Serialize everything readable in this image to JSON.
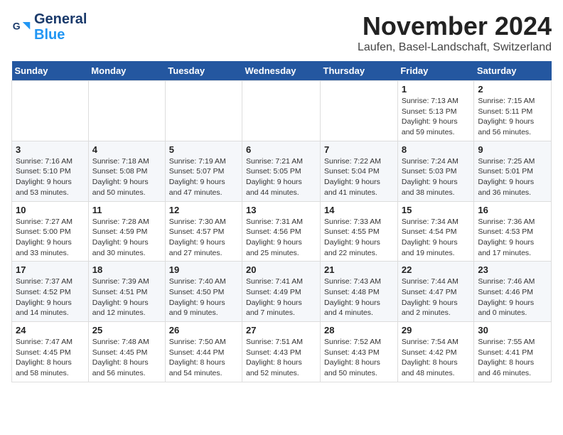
{
  "logo": {
    "line1": "General",
    "line2": "Blue"
  },
  "title": {
    "month": "November 2024",
    "location": "Laufen, Basel-Landschaft, Switzerland"
  },
  "weekdays": [
    "Sunday",
    "Monday",
    "Tuesday",
    "Wednesday",
    "Thursday",
    "Friday",
    "Saturday"
  ],
  "weeks": [
    [
      {
        "day": "",
        "info": ""
      },
      {
        "day": "",
        "info": ""
      },
      {
        "day": "",
        "info": ""
      },
      {
        "day": "",
        "info": ""
      },
      {
        "day": "",
        "info": ""
      },
      {
        "day": "1",
        "info": "Sunrise: 7:13 AM\nSunset: 5:13 PM\nDaylight: 9 hours and 59 minutes."
      },
      {
        "day": "2",
        "info": "Sunrise: 7:15 AM\nSunset: 5:11 PM\nDaylight: 9 hours and 56 minutes."
      }
    ],
    [
      {
        "day": "3",
        "info": "Sunrise: 7:16 AM\nSunset: 5:10 PM\nDaylight: 9 hours and 53 minutes."
      },
      {
        "day": "4",
        "info": "Sunrise: 7:18 AM\nSunset: 5:08 PM\nDaylight: 9 hours and 50 minutes."
      },
      {
        "day": "5",
        "info": "Sunrise: 7:19 AM\nSunset: 5:07 PM\nDaylight: 9 hours and 47 minutes."
      },
      {
        "day": "6",
        "info": "Sunrise: 7:21 AM\nSunset: 5:05 PM\nDaylight: 9 hours and 44 minutes."
      },
      {
        "day": "7",
        "info": "Sunrise: 7:22 AM\nSunset: 5:04 PM\nDaylight: 9 hours and 41 minutes."
      },
      {
        "day": "8",
        "info": "Sunrise: 7:24 AM\nSunset: 5:03 PM\nDaylight: 9 hours and 38 minutes."
      },
      {
        "day": "9",
        "info": "Sunrise: 7:25 AM\nSunset: 5:01 PM\nDaylight: 9 hours and 36 minutes."
      }
    ],
    [
      {
        "day": "10",
        "info": "Sunrise: 7:27 AM\nSunset: 5:00 PM\nDaylight: 9 hours and 33 minutes."
      },
      {
        "day": "11",
        "info": "Sunrise: 7:28 AM\nSunset: 4:59 PM\nDaylight: 9 hours and 30 minutes."
      },
      {
        "day": "12",
        "info": "Sunrise: 7:30 AM\nSunset: 4:57 PM\nDaylight: 9 hours and 27 minutes."
      },
      {
        "day": "13",
        "info": "Sunrise: 7:31 AM\nSunset: 4:56 PM\nDaylight: 9 hours and 25 minutes."
      },
      {
        "day": "14",
        "info": "Sunrise: 7:33 AM\nSunset: 4:55 PM\nDaylight: 9 hours and 22 minutes."
      },
      {
        "day": "15",
        "info": "Sunrise: 7:34 AM\nSunset: 4:54 PM\nDaylight: 9 hours and 19 minutes."
      },
      {
        "day": "16",
        "info": "Sunrise: 7:36 AM\nSunset: 4:53 PM\nDaylight: 9 hours and 17 minutes."
      }
    ],
    [
      {
        "day": "17",
        "info": "Sunrise: 7:37 AM\nSunset: 4:52 PM\nDaylight: 9 hours and 14 minutes."
      },
      {
        "day": "18",
        "info": "Sunrise: 7:39 AM\nSunset: 4:51 PM\nDaylight: 9 hours and 12 minutes."
      },
      {
        "day": "19",
        "info": "Sunrise: 7:40 AM\nSunset: 4:50 PM\nDaylight: 9 hours and 9 minutes."
      },
      {
        "day": "20",
        "info": "Sunrise: 7:41 AM\nSunset: 4:49 PM\nDaylight: 9 hours and 7 minutes."
      },
      {
        "day": "21",
        "info": "Sunrise: 7:43 AM\nSunset: 4:48 PM\nDaylight: 9 hours and 4 minutes."
      },
      {
        "day": "22",
        "info": "Sunrise: 7:44 AM\nSunset: 4:47 PM\nDaylight: 9 hours and 2 minutes."
      },
      {
        "day": "23",
        "info": "Sunrise: 7:46 AM\nSunset: 4:46 PM\nDaylight: 9 hours and 0 minutes."
      }
    ],
    [
      {
        "day": "24",
        "info": "Sunrise: 7:47 AM\nSunset: 4:45 PM\nDaylight: 8 hours and 58 minutes."
      },
      {
        "day": "25",
        "info": "Sunrise: 7:48 AM\nSunset: 4:45 PM\nDaylight: 8 hours and 56 minutes."
      },
      {
        "day": "26",
        "info": "Sunrise: 7:50 AM\nSunset: 4:44 PM\nDaylight: 8 hours and 54 minutes."
      },
      {
        "day": "27",
        "info": "Sunrise: 7:51 AM\nSunset: 4:43 PM\nDaylight: 8 hours and 52 minutes."
      },
      {
        "day": "28",
        "info": "Sunrise: 7:52 AM\nSunset: 4:43 PM\nDaylight: 8 hours and 50 minutes."
      },
      {
        "day": "29",
        "info": "Sunrise: 7:54 AM\nSunset: 4:42 PM\nDaylight: 8 hours and 48 minutes."
      },
      {
        "day": "30",
        "info": "Sunrise: 7:55 AM\nSunset: 4:41 PM\nDaylight: 8 hours and 46 minutes."
      }
    ]
  ]
}
